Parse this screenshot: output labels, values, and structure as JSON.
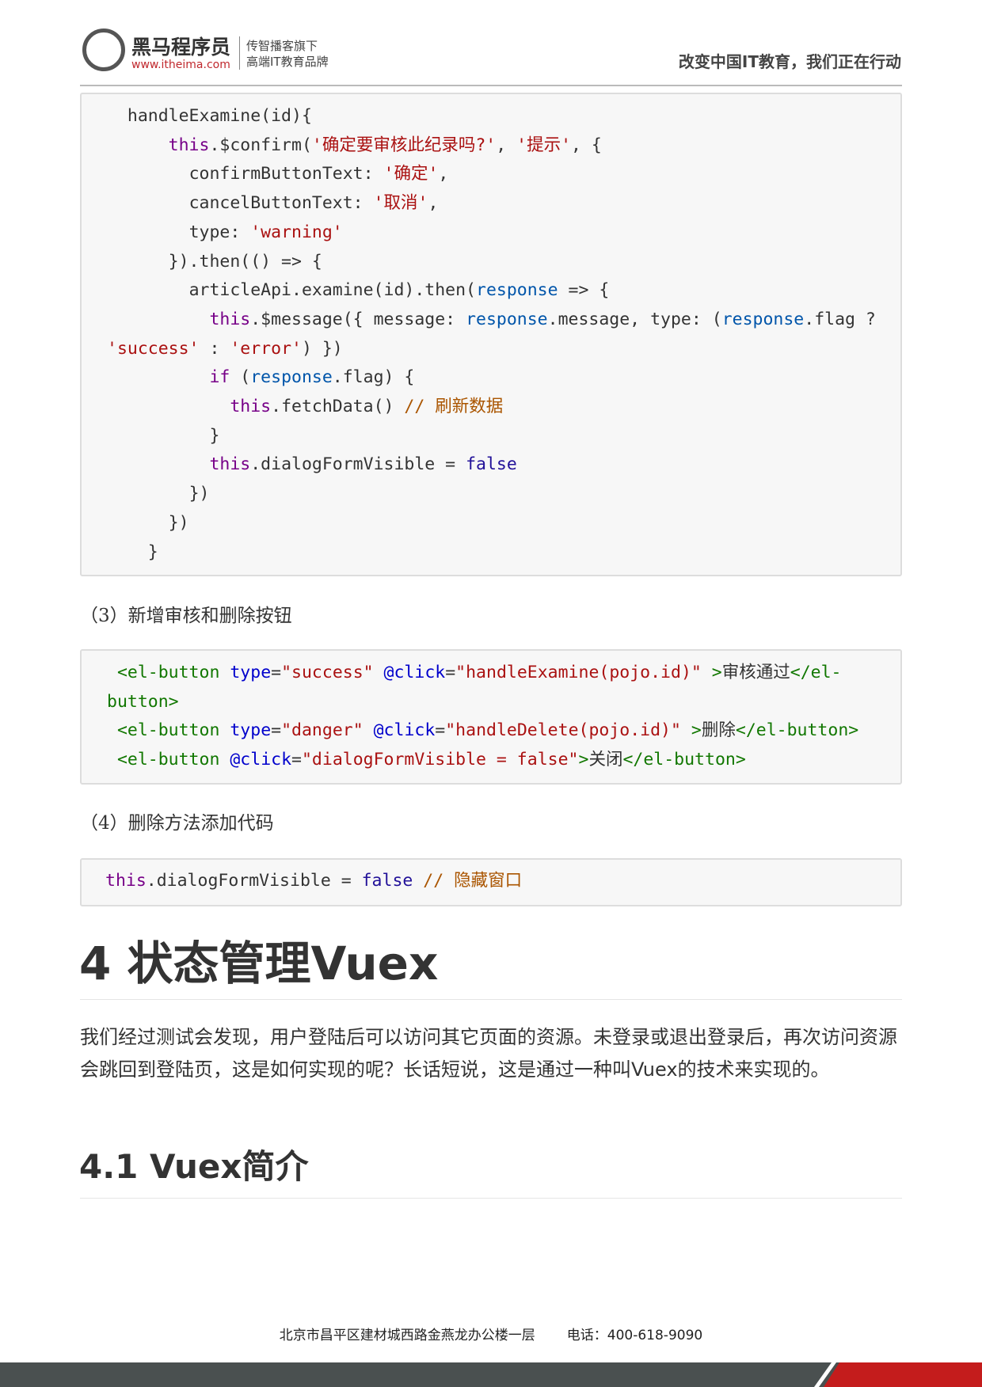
{
  "header": {
    "logo_name": "黑马程序员",
    "logo_url": "www.itheima.com",
    "logo_sub1": "传智播客旗下",
    "logo_sub2": "高端IT教育品牌",
    "slogan": "改变中国IT教育，我们正在行动"
  },
  "code1": [
    [
      [
        "  handleExamine(id){",
        ""
      ]
    ],
    [
      [
        "      ",
        ""
      ],
      [
        "this",
        "kw"
      ],
      [
        ".$confirm(",
        ""
      ],
      [
        "'确定要审核此纪录吗?'",
        "str"
      ],
      [
        ", ",
        ""
      ],
      [
        "'提示'",
        "str"
      ],
      [
        ", {",
        ""
      ]
    ],
    [
      [
        "        confirmButtonText: ",
        ""
      ],
      [
        "'确定'",
        "str"
      ],
      [
        ",",
        ""
      ]
    ],
    [
      [
        "        cancelButtonText: ",
        ""
      ],
      [
        "'取消'",
        "str"
      ],
      [
        ",",
        ""
      ]
    ],
    [
      [
        "        type: ",
        ""
      ],
      [
        "'warning'",
        "str"
      ]
    ],
    [
      [
        "      }).then(() => {",
        ""
      ]
    ],
    [
      [
        "        articleApi.examine(id).then(",
        ""
      ],
      [
        "response",
        "var"
      ],
      [
        " => {",
        ""
      ]
    ],
    [
      [
        "          ",
        ""
      ],
      [
        "this",
        "kw"
      ],
      [
        ".$message({ message: ",
        ""
      ],
      [
        "response",
        "var"
      ],
      [
        ".message, type: (",
        ""
      ],
      [
        "response",
        "var"
      ],
      [
        ".flag ? ",
        ""
      ],
      [
        "'success'",
        "str"
      ],
      [
        " : ",
        ""
      ],
      [
        "'error'",
        "str"
      ],
      [
        ") })",
        ""
      ]
    ],
    [
      [
        "          ",
        ""
      ],
      [
        "if",
        "kw"
      ],
      [
        " (",
        ""
      ],
      [
        "response",
        "var"
      ],
      [
        ".flag) {",
        ""
      ]
    ],
    [
      [
        "            ",
        ""
      ],
      [
        "this",
        "kw"
      ],
      [
        ".fetchData() ",
        ""
      ],
      [
        "// 刷新数据",
        "cm"
      ]
    ],
    [
      [
        "          }",
        ""
      ]
    ],
    [
      [
        "          ",
        ""
      ],
      [
        "this",
        "kw"
      ],
      [
        ".dialogFormVisible = ",
        ""
      ],
      [
        "false",
        "atom"
      ]
    ],
    [
      [
        "        })",
        ""
      ]
    ],
    [
      [
        "      })",
        ""
      ]
    ],
    [
      [
        "    }",
        ""
      ]
    ]
  ],
  "step3": "（3）新增审核和删除按钮",
  "code2": [
    [
      [
        " ",
        ""
      ],
      [
        "<el-button",
        "tag"
      ],
      [
        " ",
        ""
      ],
      [
        "type",
        "attr"
      ],
      [
        "=",
        ""
      ],
      [
        "\"success\"",
        "str"
      ],
      [
        " ",
        ""
      ],
      [
        "@click",
        "attr"
      ],
      [
        "=",
        ""
      ],
      [
        "\"handleExamine(pojo.id)\"",
        "str"
      ],
      [
        " ",
        ""
      ],
      [
        ">",
        "tag"
      ],
      [
        "审核通过",
        ""
      ],
      [
        "</el-button>",
        "tag"
      ]
    ],
    [
      [
        " ",
        ""
      ],
      [
        "<el-button",
        "tag"
      ],
      [
        " ",
        ""
      ],
      [
        "type",
        "attr"
      ],
      [
        "=",
        ""
      ],
      [
        "\"danger\"",
        "str"
      ],
      [
        " ",
        ""
      ],
      [
        "@click",
        "attr"
      ],
      [
        "=",
        ""
      ],
      [
        "\"handleDelete(pojo.id)\"",
        "str"
      ],
      [
        " ",
        ""
      ],
      [
        ">",
        "tag"
      ],
      [
        "删除",
        ""
      ],
      [
        "</el-button>",
        "tag"
      ]
    ],
    [
      [
        " ",
        ""
      ],
      [
        "<el-button",
        "tag"
      ],
      [
        " ",
        ""
      ],
      [
        "@click",
        "attr"
      ],
      [
        "=",
        ""
      ],
      [
        "\"dialogFormVisible = false\"",
        "str"
      ],
      [
        ">",
        "tag"
      ],
      [
        "关闭",
        ""
      ],
      [
        "</el-button>",
        "tag"
      ]
    ]
  ],
  "step4": "（4）删除方法添加代码",
  "code3": [
    [
      [
        "this",
        "kw"
      ],
      [
        ".dialogFormVisible = ",
        ""
      ],
      [
        "false",
        "atom"
      ],
      [
        " ",
        ""
      ],
      [
        "// 隐藏窗口",
        "cm"
      ]
    ]
  ],
  "h1": "4 状态管理Vuex",
  "paragraph": "我们经过测试会发现，用户登陆后可以访问其它页面的资源。未登录或退出登录后，再次访问资源会跳回到登陆页，这是如何实现的呢？长话短说，这是通过一种叫Vuex的技术来实现的。",
  "h2": "4.1 Vuex简介",
  "footer": {
    "address": "北京市昌平区建材城西路金燕龙办公楼一层",
    "phone": "电话：400-618-9090"
  }
}
